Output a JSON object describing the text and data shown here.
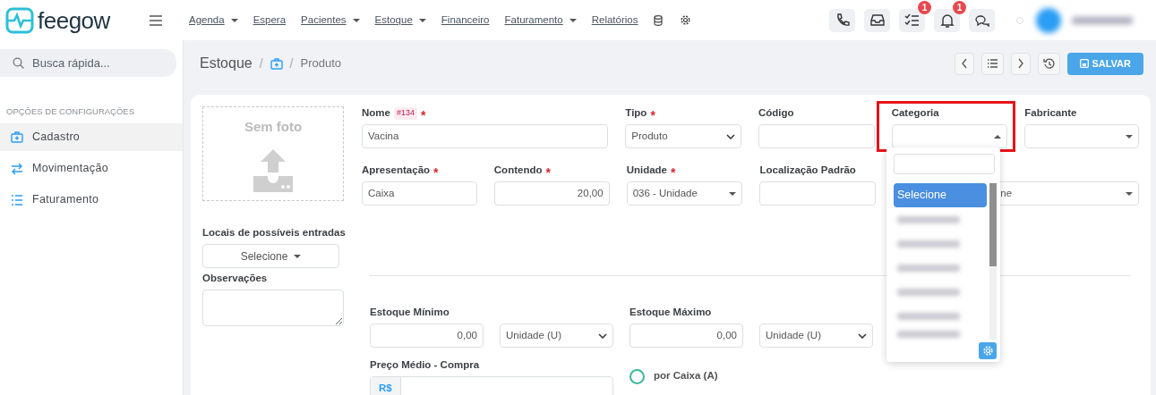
{
  "logo": {
    "text": "feegow"
  },
  "nav": [
    {
      "label": "Agenda",
      "dropdown": true
    },
    {
      "label": "Espera",
      "dropdown": false
    },
    {
      "label": "Pacientes",
      "dropdown": true
    },
    {
      "label": "Estoque",
      "dropdown": true
    },
    {
      "label": "Financeiro",
      "dropdown": false
    },
    {
      "label": "Faturamento",
      "dropdown": true
    },
    {
      "label": "Relatórios",
      "dropdown": false
    }
  ],
  "header_buttons": [
    {
      "kind": "phone"
    },
    {
      "kind": "inbox"
    },
    {
      "kind": "tasks",
      "badge": "1"
    },
    {
      "kind": "bell",
      "badge": "1"
    },
    {
      "kind": "chat"
    }
  ],
  "user": {
    "kind": "redacted"
  },
  "sidebar": {
    "search": {
      "placeholder": "Busca rápida..."
    },
    "heading": "OPÇÕES DE CONFIGURAÇÕES",
    "items": [
      {
        "label": "Cadastro",
        "kind": "kit",
        "selected": true
      },
      {
        "label": "Movimentação",
        "kind": "swap",
        "selected": false
      },
      {
        "label": "Faturamento",
        "kind": "list",
        "selected": false
      }
    ]
  },
  "breadcrumb": {
    "title": "Estoque",
    "sep": "/",
    "sep2": "/",
    "current": "Produto"
  },
  "toolbar": {
    "save": "SALVAR"
  },
  "photo": {
    "label": "Sem foto"
  },
  "locais": {
    "label": "Locais de possíveis entradas",
    "value": "Selecione"
  },
  "observacoes": {
    "label": "Observações"
  },
  "row1": [
    {
      "label": "Nome",
      "tag": "#134",
      "required_mark": "*",
      "kind": "text",
      "value": "Vacina"
    },
    {
      "label": "Tipo",
      "required_mark": "*",
      "kind": "select",
      "value": "Produto"
    },
    {
      "label": "Código",
      "kind": "text"
    },
    {
      "label": "Categoria",
      "kind": "combo",
      "highlighted": true
    },
    {
      "label": "Fabricante",
      "kind": "combo"
    }
  ],
  "row2": [
    {
      "label": "Apresentação",
      "required_mark": "*",
      "kind": "text",
      "value": "Caixa"
    },
    {
      "label": "Contendo",
      "required_mark": "*",
      "kind": "number",
      "value": "20,00"
    },
    {
      "label": "Unidade",
      "required_mark": "*",
      "kind": "combo",
      "value": "036 - Unidade"
    },
    {
      "label": "Localização Padrão",
      "kind": "text"
    },
    {
      "kind": "tail",
      "value": "ne"
    }
  ],
  "dropdown": {
    "options": [
      {
        "label": "Selecione",
        "selected": true
      },
      {
        "kind": "redacted",
        "selected": false
      },
      {
        "kind": "redacted",
        "selected": false
      },
      {
        "kind": "redacted",
        "selected": false
      },
      {
        "kind": "redacted",
        "selected": false
      },
      {
        "kind": "redacted",
        "selected": false
      },
      {
        "kind": "redacted",
        "selected": false
      }
    ]
  },
  "estoque": [
    {
      "label": "Estoque Mínimo",
      "value": "0,00",
      "unit": "Unidade (U)"
    },
    {
      "label": "Estoque Máximo",
      "value": "0,00",
      "unit": "Unidade (U)"
    }
  ],
  "preco": {
    "label": "Preço Médio - Compra",
    "prefix": "R$"
  },
  "radios": [
    {
      "label": "por Caixa (A)",
      "selected": false
    }
  ]
}
